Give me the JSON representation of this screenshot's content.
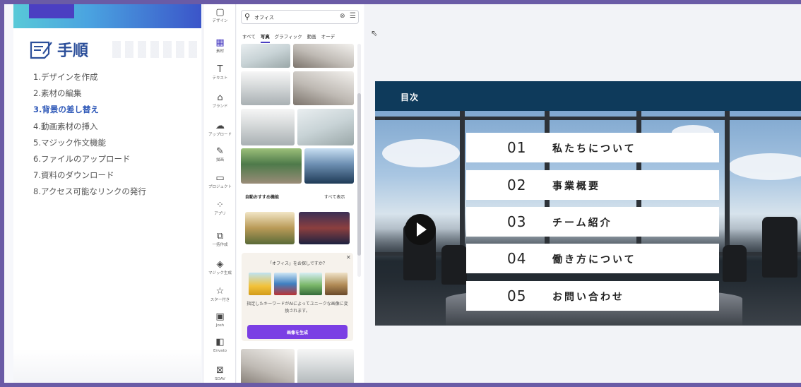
{
  "tutorial": {
    "title": "手順",
    "steps": [
      "1.デザインを作成",
      "2.素材の編集",
      "3.背景の差し替え",
      "4.動画素材の挿入",
      "5.マジック作文機能",
      "6.ファイルのアップロード",
      "7.資料のダウンロード",
      "8.アクセス可能なリンクの発行"
    ],
    "active_index": 2
  },
  "rail": {
    "items": [
      {
        "label": "デザイン",
        "icon": "design-icon"
      },
      {
        "label": "素材",
        "icon": "elements-icon"
      },
      {
        "label": "テキスト",
        "icon": "text-icon"
      },
      {
        "label": "ブランド",
        "icon": "brand-icon"
      },
      {
        "label": "アップロード",
        "icon": "upload-icon"
      },
      {
        "label": "描画",
        "icon": "draw-icon"
      },
      {
        "label": "プロジェクト",
        "icon": "projects-icon"
      },
      {
        "label": "アプリ",
        "icon": "apps-icon"
      },
      {
        "label": "一括作成",
        "icon": "bulk-create-icon"
      },
      {
        "label": "マジック生成",
        "icon": "magic-media-icon"
      },
      {
        "label": "スター付き",
        "icon": "star-icon"
      },
      {
        "label": "Josh",
        "icon": "josh-app-icon"
      },
      {
        "label": "Envato",
        "icon": "envato-icon"
      },
      {
        "label": "SDAV",
        "icon": "sdav-icon"
      }
    ]
  },
  "media": {
    "search_value": "オフィス",
    "clear_icon": "clear-icon",
    "filter_icon": "filter-icon",
    "categories": [
      "すべて",
      "写真",
      "グラフィック",
      "動画",
      "オーデ"
    ],
    "active_category": 1,
    "auto_suggest": {
      "title": "自動おすすめ機能",
      "see_all": "すべて表示"
    },
    "ai_card": {
      "question": "「オフィス」をお探しですか？",
      "description": "指定したキーワードがAIによってユニークな画像に変換されます。",
      "button": "画像を生成"
    }
  },
  "slide": {
    "header": "目次",
    "items": [
      {
        "num": "01",
        "text": "私たちについて"
      },
      {
        "num": "02",
        "text": "事業概要"
      },
      {
        "num": "03",
        "text": "チーム紹介"
      },
      {
        "num": "04",
        "text": "働き方について"
      },
      {
        "num": "05",
        "text": "お問い合わせ"
      }
    ]
  },
  "colors": {
    "frame": "#6a5ba6",
    "accent": "#4b3fc2",
    "slide_header": "#0e3a5b",
    "generate_button": "#7b3fe4"
  }
}
